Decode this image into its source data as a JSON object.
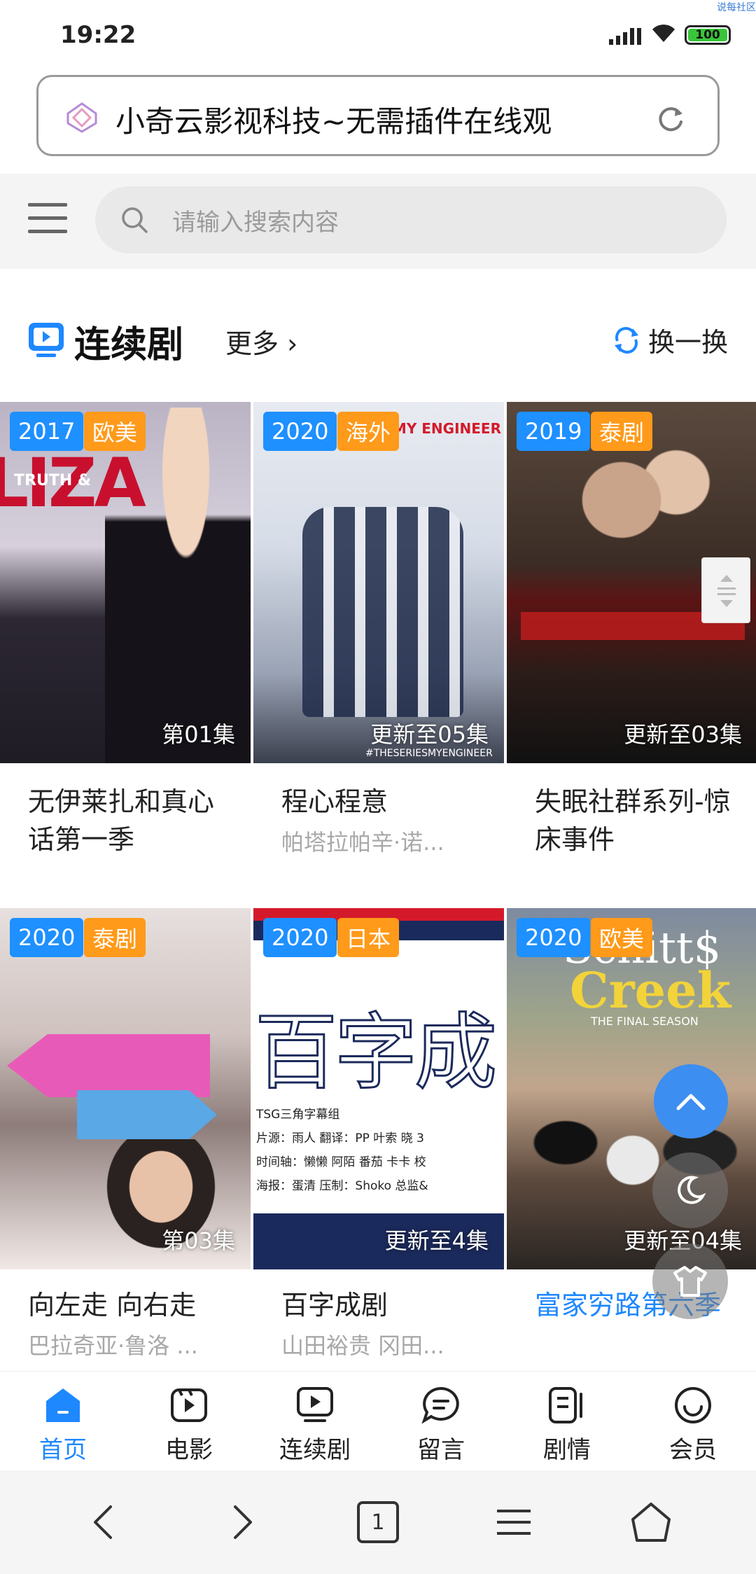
{
  "status": {
    "time": "19:22",
    "battery": "100",
    "corner_tag": "说每社区"
  },
  "urlbar": {
    "title": "小奇云影视科技~无需插件在线观"
  },
  "search": {
    "placeholder": "请输入搜索内容"
  },
  "section": {
    "title": "连续剧",
    "more": "更多",
    "swap": "换一换"
  },
  "cards": [
    {
      "year": "2017",
      "region": "欧美",
      "episode": "第01集",
      "title": "无伊莱扎和真心话第一季",
      "sub": "",
      "poster_bg": "#3b3440"
    },
    {
      "year": "2020",
      "region": "海外",
      "episode": "更新至05集",
      "title": "程心程意",
      "sub": "帕塔拉帕辛·诺...",
      "poster_bg": "#cfd7e6"
    },
    {
      "year": "2019",
      "region": "泰剧",
      "episode": "更新至03集",
      "title": "失眠社群系列-惊床事件",
      "sub": "",
      "poster_bg": "#3a2a24"
    },
    {
      "year": "2020",
      "region": "泰剧",
      "episode": "第03集",
      "title": "向左走 向右走",
      "sub": "巴拉奇亚·鲁洛 ...",
      "poster_bg": "#6d6160"
    },
    {
      "year": "2020",
      "region": "日本",
      "episode": "更新至4集",
      "title": "百字成剧",
      "sub": "山田裕贵 冈田...",
      "poster_bg": "#ffffff"
    },
    {
      "year": "2020",
      "region": "欧美",
      "episode": "更新至04集",
      "title": "富家穷路第六季",
      "sub": "",
      "poster_bg": "#6b7b5a"
    }
  ],
  "poster_text": {
    "c1_logo": "LIZA",
    "c1_caption": "TRUTH &",
    "c2_logo": "MY ENGINEER",
    "c2_hashtag": "#THESERIESMYENGINEER",
    "c5_big": "百字成",
    "c5_lines": [
      "TSG三角字幕组",
      "片源：雨人   翻译：PP  叶索  晓  3",
      "时间轴：懒懒  阿陌  番茄  卡卡  校",
      "海报：蛋清   压制：Shoko   总监&"
    ],
    "c6_logo1": "Schitt$",
    "c6_logo2": "Creek",
    "c6_caption": "THE FINAL SEASON"
  },
  "tabs": [
    {
      "label": "首页",
      "icon": "home-icon",
      "active": true
    },
    {
      "label": "电影",
      "icon": "film-icon"
    },
    {
      "label": "连续剧",
      "icon": "tv-icon"
    },
    {
      "label": "留言",
      "icon": "message-icon"
    },
    {
      "label": "剧情",
      "icon": "story-icon"
    },
    {
      "label": "会员",
      "icon": "member-icon"
    }
  ],
  "nav": {
    "tabs_count": "1"
  },
  "colors": {
    "accent": "#1e88ff",
    "year_badge": "#1e90ff",
    "region_badge": "#ff9a1a",
    "highlight_title": "#1e88ff"
  }
}
